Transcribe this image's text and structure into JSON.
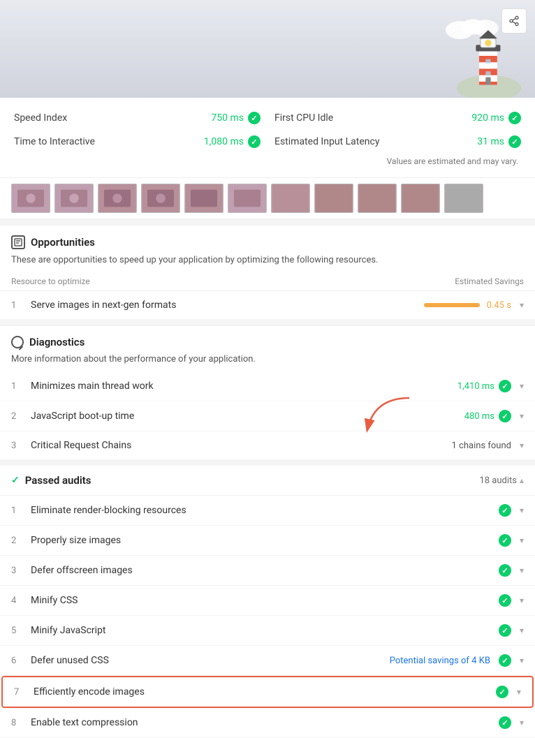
{
  "header": {
    "share_label": "Share"
  },
  "metrics": {
    "speed_index_label": "Speed Index",
    "speed_index_value": "750 ms",
    "first_cpu_idle_label": "First CPU Idle",
    "first_cpu_idle_value": "920 ms",
    "time_to_interactive_label": "Time to Interactive",
    "time_to_interactive_value": "1,080 ms",
    "estimated_input_latency_label": "Estimated Input Latency",
    "estimated_input_latency_value": "31 ms",
    "disclaimer": "Values are estimated and may vary."
  },
  "opportunities": {
    "section_title": "Opportunities",
    "section_desc": "These are opportunities to speed up your application by optimizing the following resources.",
    "col_resource": "Resource to optimize",
    "col_savings": "Estimated Savings",
    "items": [
      {
        "num": "1",
        "label": "Serve images in next-gen formats",
        "value": "0.45 s",
        "has_bar": true
      }
    ]
  },
  "diagnostics": {
    "section_title": "Diagnostics",
    "section_desc": "More information about the performance of your application.",
    "items": [
      {
        "num": "1",
        "label": "Minimizes main thread work",
        "value": "1,410 ms",
        "type": "green"
      },
      {
        "num": "2",
        "label": "JavaScript boot-up time",
        "value": "480 ms",
        "type": "green"
      },
      {
        "num": "3",
        "label": "Critical Request Chains",
        "value": "1 chains found",
        "type": "normal"
      }
    ]
  },
  "passed_audits": {
    "section_title": "Passed audits",
    "count": "18 audits",
    "items": [
      {
        "num": "1",
        "label": "Eliminate render-blocking resources",
        "value": "",
        "type": "green"
      },
      {
        "num": "2",
        "label": "Properly size images",
        "value": "",
        "type": "green"
      },
      {
        "num": "3",
        "label": "Defer offscreen images",
        "value": "",
        "type": "green"
      },
      {
        "num": "4",
        "label": "Minify CSS",
        "value": "",
        "type": "green"
      },
      {
        "num": "5",
        "label": "Minify JavaScript",
        "value": "",
        "type": "green"
      },
      {
        "num": "6",
        "label": "Defer unused CSS",
        "value": "Potential savings of 4 KB",
        "type": "green_with_savings"
      },
      {
        "num": "7",
        "label": "Efficiently encode images",
        "value": "",
        "type": "green_highlight"
      },
      {
        "num": "8",
        "label": "Enable text compression",
        "value": "",
        "type": "green"
      }
    ]
  }
}
